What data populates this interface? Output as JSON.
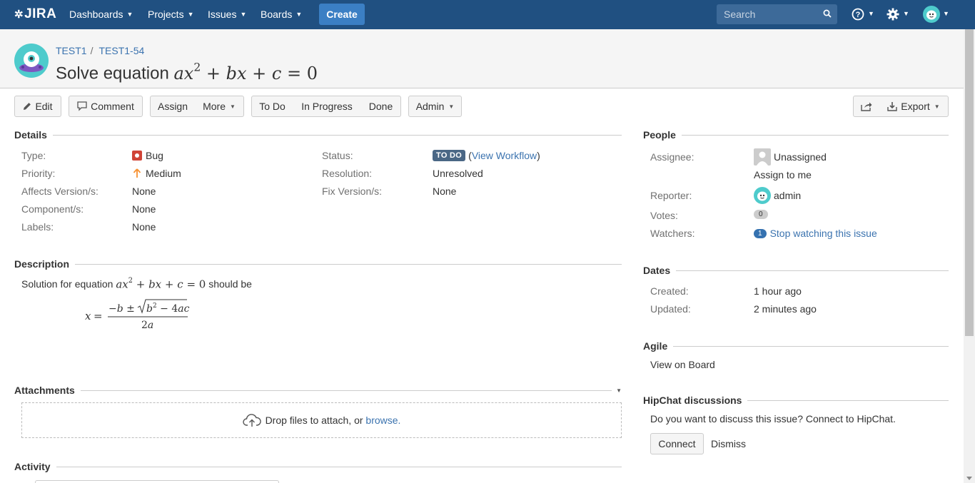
{
  "nav": {
    "logo": "JIRA",
    "items": [
      {
        "label": "Dashboards"
      },
      {
        "label": "Projects"
      },
      {
        "label": "Issues"
      },
      {
        "label": "Boards"
      }
    ],
    "create_label": "Create",
    "search_placeholder": "Search"
  },
  "header": {
    "project_key": "TEST1",
    "separator": "/",
    "issue_key": "TEST1-54",
    "title_text": "Solve equation",
    "title_math": "ax² + bx + c = 0"
  },
  "toolbar": {
    "edit": "Edit",
    "comment": "Comment",
    "assign": "Assign",
    "more": "More",
    "todo": "To Do",
    "in_progress": "In Progress",
    "done": "Done",
    "admin": "Admin",
    "export": "Export"
  },
  "details": {
    "heading": "Details",
    "type_label": "Type:",
    "type_value": "Bug",
    "priority_label": "Priority:",
    "priority_value": "Medium",
    "affects_label": "Affects Version/s:",
    "affects_value": "None",
    "component_label": "Component/s:",
    "component_value": "None",
    "labels_label": "Labels:",
    "labels_value": "None",
    "status_label": "Status:",
    "status_value": "TO DO",
    "workflow_open": "(",
    "workflow_link": "View Workflow",
    "workflow_close": ")",
    "resolution_label": "Resolution:",
    "resolution_value": "Unresolved",
    "fix_label": "Fix Version/s:",
    "fix_value": "None"
  },
  "description": {
    "heading": "Description",
    "text_before": "Solution for equation",
    "text_after": "should be"
  },
  "attachments": {
    "heading": "Attachments",
    "drop_text": "Drop files to attach, or",
    "browse_link": "browse."
  },
  "activity": {
    "heading": "Activity"
  },
  "people": {
    "heading": "People",
    "assignee_label": "Assignee:",
    "assignee_value": "Unassigned",
    "assign_to_me": "Assign to me",
    "reporter_label": "Reporter:",
    "reporter_value": "admin",
    "votes_label": "Votes:",
    "votes_count": "0",
    "watchers_label": "Watchers:",
    "watchers_count": "1",
    "watch_link": "Stop watching this issue"
  },
  "dates": {
    "heading": "Dates",
    "created_label": "Created:",
    "created_value": "1 hour ago",
    "updated_label": "Updated:",
    "updated_value": "2 minutes ago"
  },
  "agile": {
    "heading": "Agile",
    "view_board": "View on Board"
  },
  "hipchat": {
    "heading": "HipChat discussions",
    "text": "Do you want to discuss this issue? Connect to HipChat.",
    "connect": "Connect",
    "dismiss": "Dismiss"
  },
  "colors": {
    "nav_bg": "#205081",
    "create_bg": "#3b7fc4",
    "link": "#3b73af",
    "bug_red": "#d04437",
    "priority_orange": "#f79232",
    "lozenge_bg": "#4a6785"
  }
}
